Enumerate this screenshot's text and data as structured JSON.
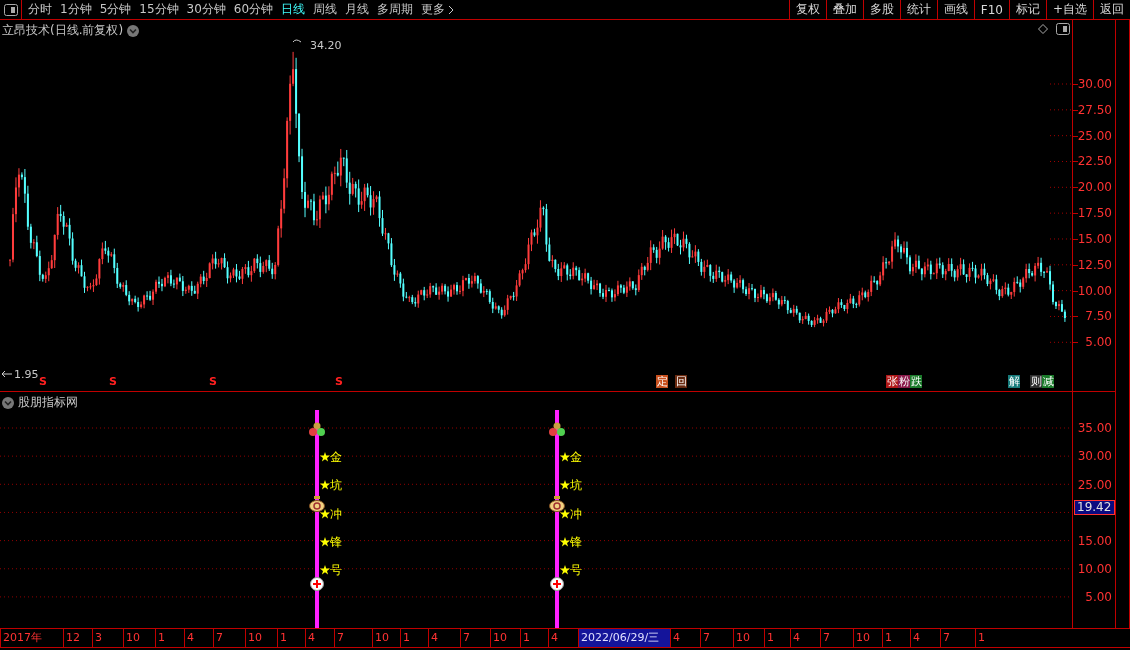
{
  "toolbar": {
    "periods": [
      {
        "label": "分时",
        "selected": false
      },
      {
        "label": "1分钟",
        "selected": false
      },
      {
        "label": "5分钟",
        "selected": false
      },
      {
        "label": "15分钟",
        "selected": false
      },
      {
        "label": "30分钟",
        "selected": false
      },
      {
        "label": "60分钟",
        "selected": false
      },
      {
        "label": "日线",
        "selected": true
      },
      {
        "label": "周线",
        "selected": false
      },
      {
        "label": "月线",
        "selected": false
      },
      {
        "label": "多周期",
        "selected": false
      },
      {
        "label": "更多",
        "selected": false
      }
    ],
    "actions": [
      "复权",
      "叠加",
      "多股",
      "统计",
      "画线",
      "F10",
      "标记",
      "+自选",
      "返回"
    ]
  },
  "main_chart": {
    "title": "立昂技术(日线.前复权)",
    "high_label": "34.20",
    "low_label": "1.95",
    "y_axis": [
      "30.00",
      "27.50",
      "25.00",
      "22.50",
      "20.00",
      "17.50",
      "15.00",
      "12.50",
      "10.00",
      "7.50",
      "5.00"
    ],
    "markers": [
      {
        "label": "S"
      },
      {
        "label": "S"
      },
      {
        "label": "S"
      },
      {
        "label": "S"
      }
    ],
    "event_badges": [
      {
        "label": "定",
        "color": "#c8501e"
      },
      {
        "label": "回",
        "color": "#6a2a10"
      },
      {
        "label": "张",
        "color": "#b01818"
      },
      {
        "label": "粉",
        "color": "#8a1a4a"
      },
      {
        "label": "跌",
        "color": "#1a7a2a"
      },
      {
        "label": "解",
        "color": "#167a7a"
      },
      {
        "label": "则",
        "color": "#303030"
      },
      {
        "label": "减",
        "color": "#1a7a2a"
      }
    ]
  },
  "indicator": {
    "title": "股朋指标网",
    "signals": [
      {
        "labels": [
          "金",
          "坑",
          "冲",
          "锋",
          "号"
        ]
      },
      {
        "labels": [
          "金",
          "坑",
          "冲",
          "锋",
          "号"
        ]
      }
    ],
    "y_axis": [
      "35.00",
      "30.00",
      "25.00",
      "15.00",
      "10.00",
      "5.00"
    ],
    "current_value": "19.42"
  },
  "date_axis": {
    "ticks": [
      {
        "label": "2017年",
        "selected": false
      },
      {
        "label": "12",
        "selected": false
      },
      {
        "label": "3",
        "selected": false
      },
      {
        "label": "10",
        "selected": false
      },
      {
        "label": "1",
        "selected": false
      },
      {
        "label": "4",
        "selected": false
      },
      {
        "label": "7",
        "selected": false
      },
      {
        "label": "10",
        "selected": false
      },
      {
        "label": "1",
        "selected": false
      },
      {
        "label": "4",
        "selected": false
      },
      {
        "label": "7",
        "selected": false
      },
      {
        "label": "10",
        "selected": false
      },
      {
        "label": "1",
        "selected": false
      },
      {
        "label": "4",
        "selected": false
      },
      {
        "label": "7",
        "selected": false
      },
      {
        "label": "10",
        "selected": false
      },
      {
        "label": "1",
        "selected": false
      },
      {
        "label": "4",
        "selected": false
      },
      {
        "label": "2022/06/29/三",
        "selected": true
      },
      {
        "label": "4",
        "selected": false
      },
      {
        "label": "7",
        "selected": false
      },
      {
        "label": "10",
        "selected": false
      },
      {
        "label": "1",
        "selected": false
      },
      {
        "label": "4",
        "selected": false
      },
      {
        "label": "7",
        "selected": false
      },
      {
        "label": "10",
        "selected": false
      },
      {
        "label": "1",
        "selected": false
      },
      {
        "label": "4",
        "selected": false
      },
      {
        "label": "7",
        "selected": false
      },
      {
        "label": "1",
        "selected": false
      }
    ]
  }
}
